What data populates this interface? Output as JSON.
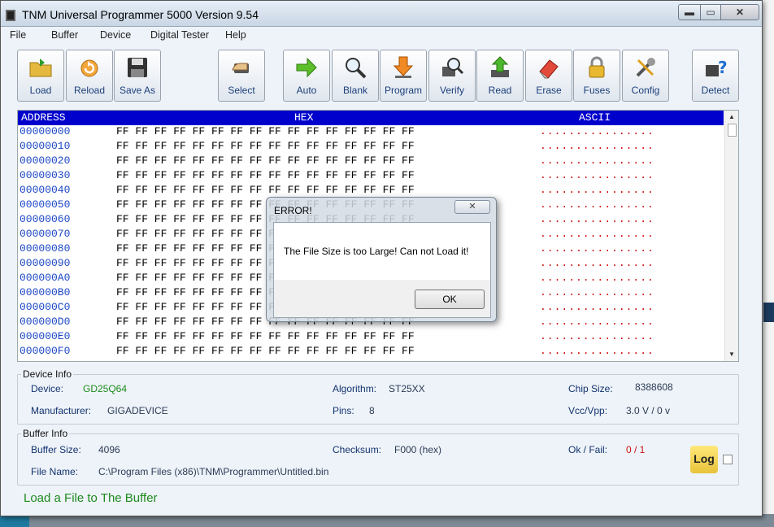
{
  "window": {
    "title": "TNM  Universal Programmer 5000   Version 9.54",
    "min_label": "▬",
    "max_label": "▭",
    "close_label": "✕"
  },
  "menu": [
    "File",
    "Buffer",
    "Device",
    "Digital Tester",
    "Help"
  ],
  "toolbar": [
    "Load",
    "Reload",
    "Save As",
    "Select",
    "Auto",
    "Blank",
    "Program",
    "Verify",
    "Read",
    "Erase",
    "Fuses",
    "Config",
    "Detect"
  ],
  "hex": {
    "header_address": "ADDRESS",
    "header_hex": "HEX",
    "header_ascii": "ASCII",
    "rows": [
      {
        "addr": "00000000",
        "bytes": "FF FF FF FF FF FF FF FF FF FF FF FF FF FF FF FF",
        "ascii": "................"
      },
      {
        "addr": "00000010",
        "bytes": "FF FF FF FF FF FF FF FF FF FF FF FF FF FF FF FF",
        "ascii": "................"
      },
      {
        "addr": "00000020",
        "bytes": "FF FF FF FF FF FF FF FF FF FF FF FF FF FF FF FF",
        "ascii": "................"
      },
      {
        "addr": "00000030",
        "bytes": "FF FF FF FF FF FF FF FF FF FF FF FF FF FF FF FF",
        "ascii": "................"
      },
      {
        "addr": "00000040",
        "bytes": "FF FF FF FF FF FF FF FF FF FF FF FF FF FF FF FF",
        "ascii": "................"
      },
      {
        "addr": "00000050",
        "bytes": "FF FF FF FF FF FF FF FF FF FF FF FF FF FF FF FF",
        "ascii": "................"
      },
      {
        "addr": "00000060",
        "bytes": "FF FF FF FF FF FF FF FF FF FF FF FF FF FF FF FF",
        "ascii": "................"
      },
      {
        "addr": "00000070",
        "bytes": "FF FF FF FF FF FF FF FF FF FF FF FF FF FF FF FF",
        "ascii": "................"
      },
      {
        "addr": "00000080",
        "bytes": "FF FF FF FF FF FF FF FF FF FF FF FF FF FF FF FF",
        "ascii": "................"
      },
      {
        "addr": "00000090",
        "bytes": "FF FF FF FF FF FF FF FF FF FF FF FF FF FF FF FF",
        "ascii": "................"
      },
      {
        "addr": "000000A0",
        "bytes": "FF FF FF FF FF FF FF FF FF FF FF FF FF FF FF FF",
        "ascii": "................"
      },
      {
        "addr": "000000B0",
        "bytes": "FF FF FF FF FF FF FF FF FF FF FF FF FF FF FF FF",
        "ascii": "................"
      },
      {
        "addr": "000000C0",
        "bytes": "FF FF FF FF FF FF FF FF FF FF FF FF FF FF FF FF",
        "ascii": "................"
      },
      {
        "addr": "000000D0",
        "bytes": "FF FF FF FF FF FF FF FF FF FF FF FF FF FF FF FF",
        "ascii": "................"
      },
      {
        "addr": "000000E0",
        "bytes": "FF FF FF FF FF FF FF FF FF FF FF FF FF FF FF FF",
        "ascii": "................"
      },
      {
        "addr": "000000F0",
        "bytes": "FF FF FF FF FF FF FF FF FF FF FF FF FF FF FF FF",
        "ascii": "................"
      }
    ]
  },
  "device_info": {
    "title": "Device Info",
    "device_label": "Device:",
    "device_value": "GD25Q64",
    "algorithm_label": "Algorithm:",
    "algorithm_value": "ST25XX",
    "chip_size_label": "Chip Size:",
    "chip_size_value": "8388608",
    "manufacturer_label": "Manufacturer:",
    "manufacturer_value": "GIGADEVICE",
    "pins_label": "Pins:",
    "pins_value": "8",
    "vcc_label": "Vcc/Vpp:",
    "vcc_value": "3.0 V / 0 v"
  },
  "buffer_info": {
    "title": "Buffer Info",
    "buffer_size_label": "Buffer Size:",
    "buffer_size_value": "4096",
    "checksum_label": "Checksum:",
    "checksum_value": "F000 (hex)",
    "ok_fail_label": "Ok / Fail:",
    "ok_fail_value": "0 / 1",
    "file_name_label": "File Name:",
    "file_name_value": "C:\\Program Files (x86)\\TNM\\Programmer\\Untitled.bin",
    "log_label": "Log"
  },
  "status": "Load a File to The Buffer",
  "dialog": {
    "title": "ERROR!",
    "message": "The File Size is too Large! Can not Load it!",
    "ok_label": "OK",
    "close_label": "✕"
  }
}
